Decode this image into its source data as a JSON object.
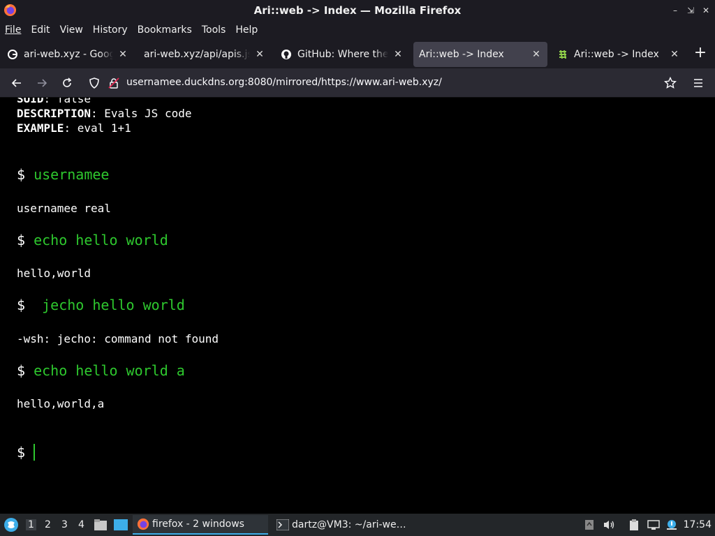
{
  "window": {
    "title": "Ari::web -> Index — Mozilla Firefox"
  },
  "menubar": {
    "items": [
      "File",
      "Edit",
      "View",
      "History",
      "Bookmarks",
      "Tools",
      "Help"
    ]
  },
  "tabs": [
    {
      "label": "ari-web.xyz - Google Search",
      "icon": "google-icon",
      "active": false
    },
    {
      "label": "ari-web.xyz/api/apis.json",
      "icon": "none",
      "active": false
    },
    {
      "label": "GitHub: Where the world builds software",
      "icon": "github-icon",
      "active": false
    },
    {
      "label": "Ari::web -> Index",
      "icon": "none",
      "active": true
    },
    {
      "label": "Ari::web -> Index",
      "icon": "ari-web-icon",
      "active": false
    }
  ],
  "navbar": {
    "url": "usernamee.duckdns.org:8080/mirrored/https://www.ari-web.xyz/"
  },
  "terminal": {
    "top_lines": [
      {
        "key": "SUID",
        "value": " false"
      },
      {
        "key": "DESCRIPTION",
        "value": " Evals JS code"
      },
      {
        "key": "EXAMPLE",
        "value": " eval 1+1"
      }
    ],
    "entries": [
      {
        "prompt": "$ ",
        "command": "usernamee",
        "output": "usernamee real"
      },
      {
        "prompt": "$ ",
        "command": "echo hello world",
        "output": "hello,world"
      },
      {
        "prompt": "$  ",
        "command": "jecho hello world",
        "output": "-wsh: jecho: command not found"
      },
      {
        "prompt": "$ ",
        "command": "echo hello world a",
        "output": "hello,world,a"
      }
    ],
    "current_prompt": "$"
  },
  "taskbar": {
    "workspaces": [
      "1",
      "2",
      "3",
      "4"
    ],
    "active_workspace": "1",
    "tasks": [
      {
        "label": "firefox - 2 windows",
        "icon": "firefox-icon",
        "active": true
      },
      {
        "label": "dartz@VM3: ~/ari-we…",
        "icon": "terminal-icon",
        "active": false
      }
    ],
    "clock": "17:54"
  },
  "colors": {
    "prompt_command": "#2ec82e",
    "chrome_bg": "#1c1b22",
    "active_tab": "#42414d"
  }
}
